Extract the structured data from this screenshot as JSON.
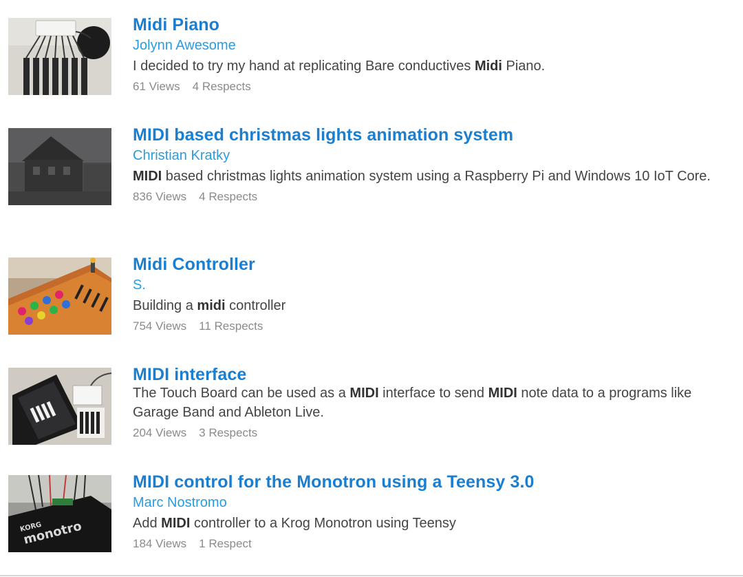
{
  "projects": [
    {
      "title": "Midi Piano",
      "author": "Jolynn Awesome",
      "desc_parts": [
        {
          "text": "I decided to try my hand at replicating Bare conductives ",
          "bold": false
        },
        {
          "text": "Midi",
          "bold": true
        },
        {
          "text": " Piano.",
          "bold": false
        }
      ],
      "views": "61 Views",
      "respects": "4 Respects"
    },
    {
      "title": "MIDI based christmas lights animation system",
      "author": "Christian Kratky",
      "desc_parts": [
        {
          "text": "MIDI",
          "bold": true
        },
        {
          "text": " based christmas lights animation system using a Raspberry Pi and Windows 10 IoT Core.",
          "bold": false
        }
      ],
      "views": "836 Views",
      "respects": "4 Respects"
    },
    {
      "title": "Midi Controller",
      "author": "S.",
      "desc_parts": [
        {
          "text": "Building a ",
          "bold": false
        },
        {
          "text": "midi",
          "bold": true
        },
        {
          "text": " controller",
          "bold": false
        }
      ],
      "views": "754 Views",
      "respects": "11 Respects"
    },
    {
      "title": "MIDI interface",
      "author": "",
      "desc_parts": [
        {
          "text": "The Touch Board can be used as a ",
          "bold": false
        },
        {
          "text": "MIDI",
          "bold": true
        },
        {
          "text": " interface to send ",
          "bold": false
        },
        {
          "text": "MIDI",
          "bold": true
        },
        {
          "text": " note data to a programs like Garage Band and Ableton Live.",
          "bold": false
        }
      ],
      "views": "204 Views",
      "respects": "3 Respects"
    },
    {
      "title": "MIDI control for the Monotron using a Teensy 3.0",
      "author": "Marc Nostromo",
      "desc_parts": [
        {
          "text": "Add ",
          "bold": false
        },
        {
          "text": "MIDI",
          "bold": true
        },
        {
          "text": " controller to a Krog Monotron using Teensy",
          "bold": false
        }
      ],
      "views": "184 Views",
      "respects": "1 Respect"
    }
  ],
  "colors": {
    "title": "#1a7fd1",
    "author": "#2a9ce0",
    "text": "#444444",
    "stats": "#8a8a8a"
  }
}
